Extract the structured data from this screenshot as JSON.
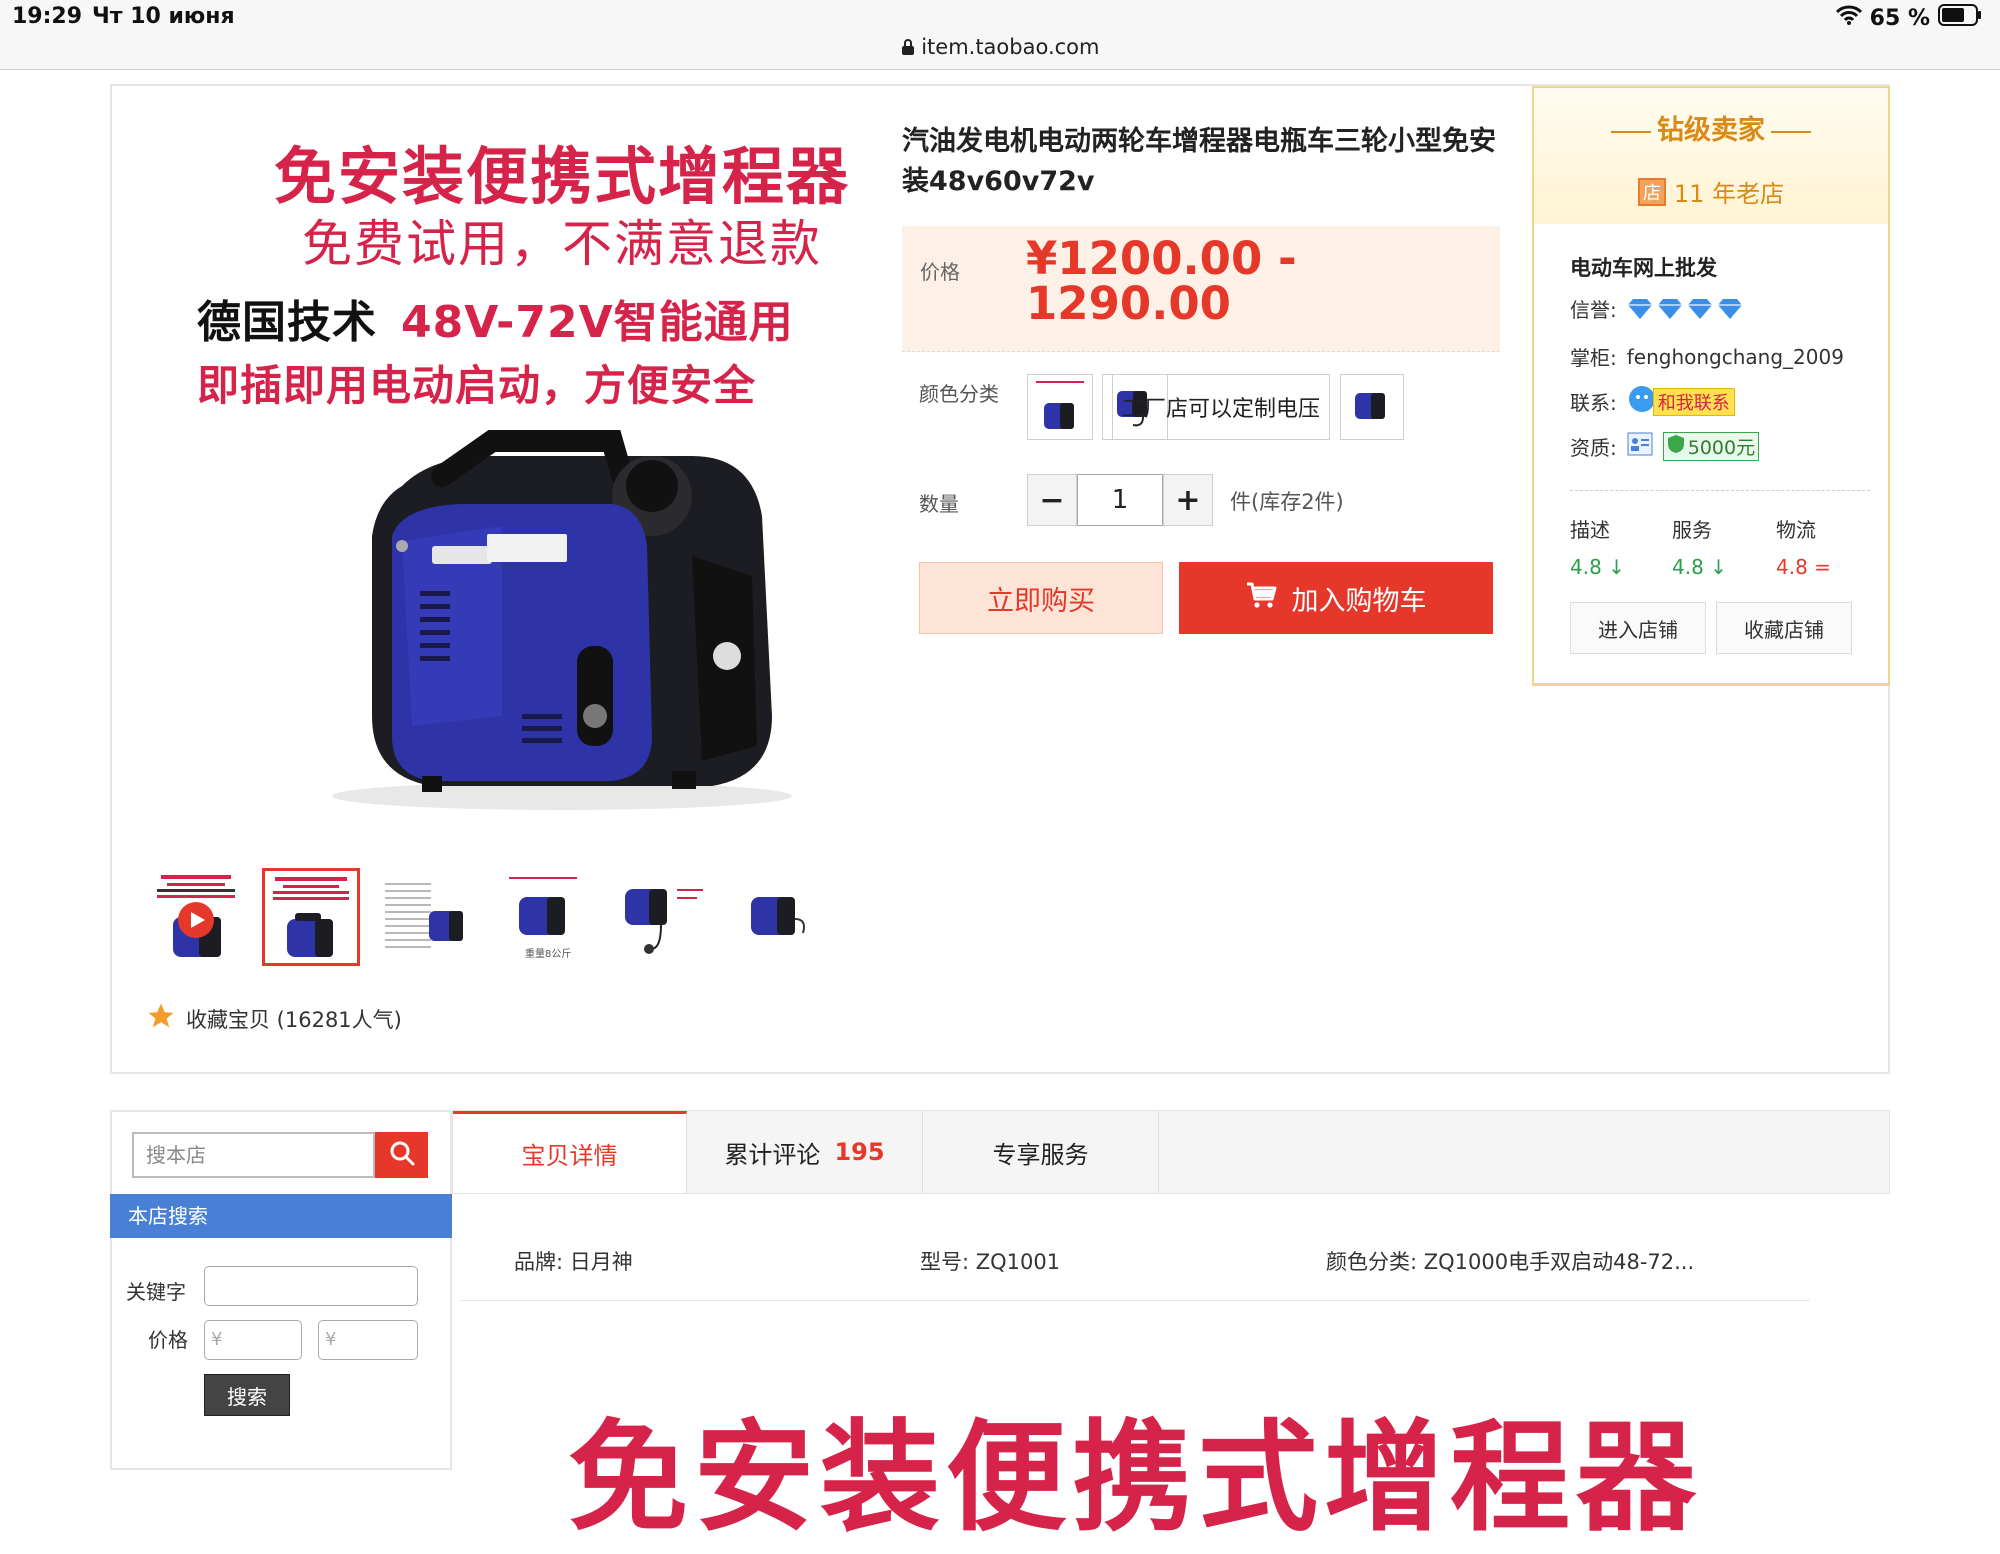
{
  "status_bar": {
    "time": "19:29",
    "date": "Чт 10 июня",
    "url": "item.taobao.com",
    "battery": "65 %"
  },
  "product": {
    "hero_line1": "免安装便携式增程器",
    "hero_line2": "免费试用，不满意退款",
    "hero_line3a": "德国技术",
    "hero_line3b": "48V-72V智能通用",
    "hero_line4": "即插即用电动启动，方便安全",
    "title": "汽油发电机电动两轮车增程器电瓶车三轮小型免安装48v60v72v",
    "price_label": "价格",
    "price": "¥1200.00 - 1290.00",
    "color_label": "颜色分类",
    "color_text_option": "工厂店可以定制电压",
    "qty_label": "数量",
    "qty_minus": "−",
    "qty_value": "1",
    "qty_plus": "+",
    "stock": "件(库存2件)",
    "buy_now": "立即购买",
    "add_to_cart": "加入购物车",
    "favorite": "收藏宝贝 (16281人气)",
    "thumb_weight_label": "重量8公斤"
  },
  "seller": {
    "level": "钻级卖家",
    "years": "11 年老店",
    "dian_icon_char": "店",
    "shop_name": "电动车网上批发",
    "credit_label": "信誉:",
    "keeper_label": "掌柜:",
    "keeper": "fenghongchang_2009",
    "contact_label": "联系:",
    "contact": "和我联系",
    "qualification_label": "资质:",
    "qualification_amount": "5000元",
    "scores": [
      {
        "label": "描述",
        "value": "4.8",
        "trend": "↓",
        "color": "#2e9e4a"
      },
      {
        "label": "服务",
        "value": "4.8",
        "trend": "↓",
        "color": "#2e9e4a"
      },
      {
        "label": "物流",
        "value": "4.8",
        "trend": "=",
        "color": "#e5382a"
      }
    ],
    "enter_shop": "进入店铺",
    "favorite_shop": "收藏店铺"
  },
  "sidebar": {
    "search_placeholder": "搜本店",
    "header": "本店搜索",
    "keyword_label": "关键字",
    "price_label": "价格",
    "price_prefix": "¥",
    "search_button": "搜索"
  },
  "tabs": [
    {
      "label": "宝贝详情"
    },
    {
      "label": "累计评论",
      "count": "195"
    },
    {
      "label": "专享服务"
    }
  ],
  "attributes": {
    "brand": "品牌: 日月神",
    "model": "型号: ZQ1001",
    "color": "颜色分类: ZQ1000电手双启动48-72..."
  },
  "detail_hero": "免安装便携式增程器",
  "colors": {
    "accent": "#e5382a",
    "hero_red": "#d6234a",
    "gold": "#d98a16",
    "sidebar_blue": "#4a7fd6"
  }
}
